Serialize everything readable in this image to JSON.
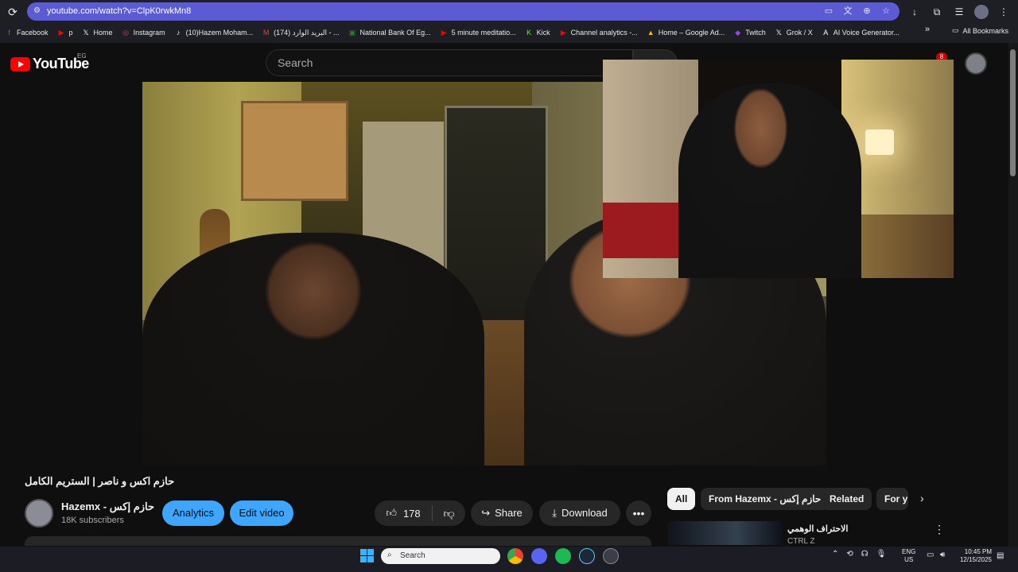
{
  "browser": {
    "url": "youtube.com/watch?v=ClpK0rwkMn8",
    "bookmarks": [
      {
        "label": "Facebook",
        "icon": "facebook-icon",
        "color": "#1877f2"
      },
      {
        "label": "p",
        "icon": "youtube-icon",
        "color": "#ff0000"
      },
      {
        "label": "Home",
        "icon": "x-icon",
        "color": "#ffffff"
      },
      {
        "label": "Instagram",
        "icon": "instagram-icon",
        "color": "#e1306c"
      },
      {
        "label": "(10)Hazem Moham...",
        "icon": "tiktok-icon",
        "color": "#ffffff"
      },
      {
        "label": "(174) البريد الوارد - ...",
        "icon": "gmail-icon",
        "color": "#ea4335"
      },
      {
        "label": "National Bank Of Eg...",
        "icon": "bank-icon",
        "color": "#2e7d32"
      },
      {
        "label": "5 minute meditatio...",
        "icon": "youtube-icon",
        "color": "#ff0000"
      },
      {
        "label": "Kick",
        "icon": "kick-icon",
        "color": "#53fc18"
      },
      {
        "label": "Channel analytics -...",
        "icon": "youtube-icon",
        "color": "#ff0000"
      },
      {
        "label": "Home – Google Ad...",
        "icon": "google-ads-icon",
        "color": "#fbbc04"
      },
      {
        "label": "Twitch",
        "icon": "twitch-icon",
        "color": "#9146ff"
      },
      {
        "label": "Grok / X",
        "icon": "x-icon",
        "color": "#ffffff"
      },
      {
        "label": "AI Voice Generator...",
        "icon": "ai-voice-icon",
        "color": "#ffffff"
      }
    ],
    "all_bookmarks": "All Bookmarks"
  },
  "youtube": {
    "logo_text": "YouTube",
    "country": "EG",
    "search_placeholder": "Search",
    "notifications_count": "8"
  },
  "video": {
    "title": "حازم اكس و ناصر | الستريم الكامل",
    "channel_name": "Hazemx - حازم إكس",
    "subscribers": "18K subscribers",
    "analytics_label": "Analytics",
    "edit_label": "Edit video",
    "likes": "178",
    "share_label": "Share",
    "download_label": "Download"
  },
  "chips": [
    "All",
    "From Hazemx - حازم إكس",
    "Related",
    "For y"
  ],
  "related": {
    "title": "الاحتراف الوهمي",
    "channel": "CTRL Z"
  },
  "taskbar": {
    "search_placeholder": "Search",
    "lang_top": "ENG",
    "lang_bottom": "US",
    "time": "10:45 PM",
    "date": "12/15/2025"
  },
  "colors": {
    "accent_blue": "#3ea6ff",
    "youtube_red": "#ff0000",
    "omnibox": "#5b5bd6"
  }
}
